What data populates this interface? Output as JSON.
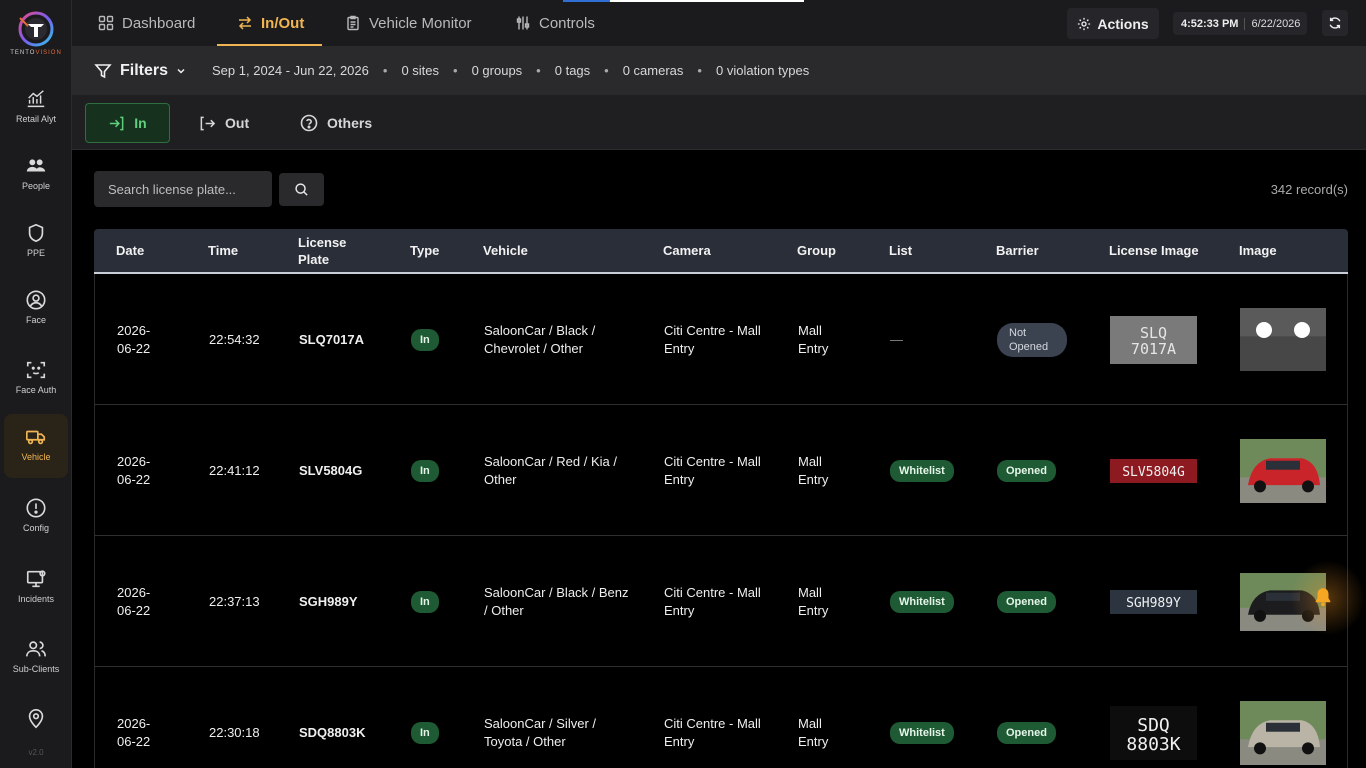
{
  "brand": {
    "name_part1": "TENTO",
    "name_part2": "VISION",
    "version": "v2.0"
  },
  "sidebar": {
    "items": [
      {
        "label": "Retail Alyt",
        "icon": "chart-line-icon"
      },
      {
        "label": "People",
        "icon": "people-icon"
      },
      {
        "label": "PPE",
        "icon": "shield-icon"
      },
      {
        "label": "Face",
        "icon": "face-icon"
      },
      {
        "label": "Face Auth",
        "icon": "face-scan-icon"
      },
      {
        "label": "Vehicle",
        "icon": "truck-icon",
        "active": true
      },
      {
        "label": "Config",
        "icon": "alert-circle-icon"
      },
      {
        "label": "Incidents",
        "icon": "monitor-gear-icon"
      },
      {
        "label": "Sub-Clients",
        "icon": "users-icon"
      },
      {
        "label": "",
        "icon": "map-pin-icon"
      }
    ]
  },
  "topnav": {
    "tabs": [
      {
        "label": "Dashboard",
        "icon": "grid-icon"
      },
      {
        "label": "In/Out",
        "icon": "swap-icon",
        "active": true
      },
      {
        "label": "Vehicle Monitor",
        "icon": "clipboard-icon"
      },
      {
        "label": "Controls",
        "icon": "controls-icon"
      }
    ],
    "actions_label": "Actions",
    "time": "4:52:33 PM",
    "date": "6/22/2026"
  },
  "filters": {
    "label": "Filters",
    "date_range": "Sep 1, 2024 - Jun 22, 2026",
    "sites": "0 sites",
    "groups": "0 groups",
    "tags": "0 tags",
    "cameras": "0 cameras",
    "violation_types": "0 violation types"
  },
  "direction_tabs": {
    "in": "In",
    "out": "Out",
    "others": "Others"
  },
  "search": {
    "placeholder": "Search license plate..."
  },
  "records": "342 record(s)",
  "table": {
    "headers": [
      "Date",
      "Time",
      "License Plate",
      "Type",
      "Vehicle",
      "Camera",
      "Group",
      "List",
      "Barrier",
      "License Image",
      "Image"
    ],
    "rows": [
      {
        "date": "2026-06-22",
        "time": "22:54:32",
        "plate": "SLQ7017A",
        "type": "In",
        "vehicle": "SaloonCar / Black / Chevrolet / Other",
        "camera": "Citi Centre - Mall Entry",
        "group": "Mall Entry",
        "list": "—",
        "barrier": "Not Opened",
        "plate_style": "grey",
        "plate_text": "SLQ 7017A",
        "car_color": "#c8c8c8"
      },
      {
        "date": "2026-06-22",
        "time": "22:41:12",
        "plate": "SLV5804G",
        "type": "In",
        "vehicle": "SaloonCar / Red / Kia / Other",
        "camera": "Citi Centre - Mall Entry",
        "group": "Mall Entry",
        "list": "Whitelist",
        "barrier": "Opened",
        "plate_style": "red",
        "plate_text": "SLV5804G",
        "car_color": "#c8242a"
      },
      {
        "date": "2026-06-22",
        "time": "22:37:13",
        "plate": "SGH989Y",
        "type": "In",
        "vehicle": "SaloonCar / Black / Benz / Other",
        "camera": "Citi Centre - Mall Entry",
        "group": "Mall Entry",
        "list": "Whitelist",
        "barrier": "Opened",
        "plate_style": "dark",
        "plate_text": "SGH989Y",
        "car_color": "#1c1c1e"
      },
      {
        "date": "2026-06-22",
        "time": "22:30:18",
        "plate": "SDQ8803K",
        "type": "In",
        "vehicle": "SaloonCar / Silver / Toyota / Other",
        "camera": "Citi Centre - Mall Entry",
        "group": "Mall Entry",
        "list": "Whitelist",
        "barrier": "Opened",
        "plate_style": "black",
        "plate_text": "SDQ 8803K",
        "car_color": "#b9b4a6"
      }
    ]
  },
  "colors": {
    "accent": "#f0b552",
    "success": "#1e5a33",
    "active_green": "#5fd07c"
  }
}
